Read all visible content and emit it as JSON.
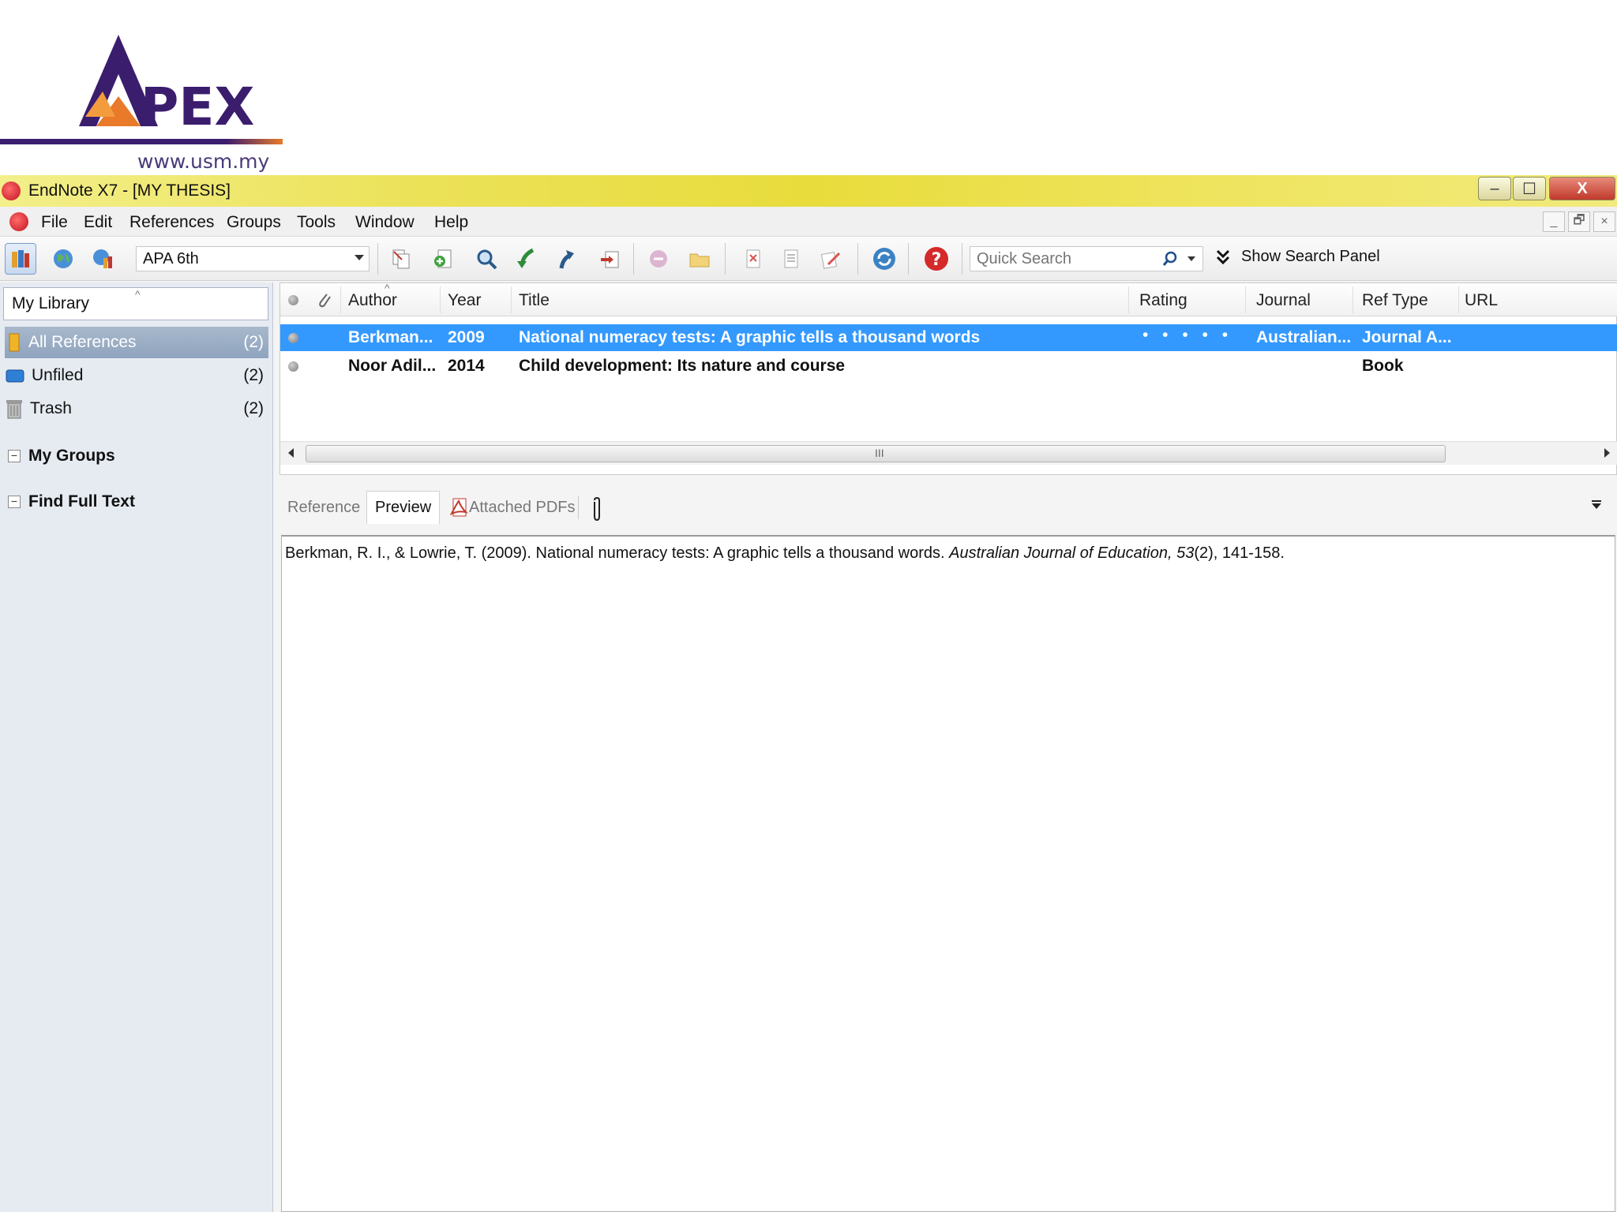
{
  "logo": {
    "text": "APEX",
    "url": "www.usm.my"
  },
  "window": {
    "title": "EndNote X7 - [MY THESIS]",
    "controls": {
      "minimize": "–",
      "maximize": "☐",
      "close": "X"
    }
  },
  "menu": {
    "items": [
      "File",
      "Edit",
      "References",
      "Groups",
      "Tools",
      "Window",
      "Help"
    ],
    "mdi": {
      "minimize": "_",
      "restore": "🗗",
      "close": "×"
    }
  },
  "toolbar": {
    "style": "APA 6th",
    "search_placeholder": "Quick Search",
    "show_search_panel": "Show Search Panel"
  },
  "library": {
    "header": "My Library",
    "items": [
      {
        "label": "All References",
        "count": "(2)",
        "selected": true
      },
      {
        "label": "Unfiled",
        "count": "(2)"
      },
      {
        "label": "Trash",
        "count": "(2)"
      }
    ],
    "groups": [
      "My Groups",
      "Find Full Text"
    ]
  },
  "reflist": {
    "columns": {
      "author": "Author",
      "year": "Year",
      "title": "Title",
      "rating": "Rating",
      "journal": "Journal",
      "reftype": "Ref Type",
      "url": "URL"
    },
    "rows": [
      {
        "author": "Berkman...",
        "year": "2009",
        "title": "National numeracy tests: A graphic tells a thousand words",
        "rating": "• • • • •",
        "journal": "Australian...",
        "reftype": "Journal A...",
        "selected": true
      },
      {
        "author": "Noor Adil...",
        "year": "2014",
        "title": "Child development: Its nature and course",
        "rating": "",
        "journal": "",
        "reftype": "Book"
      }
    ],
    "scroll_grip": "III"
  },
  "tabs": {
    "reference": "Reference",
    "preview": "Preview",
    "attached_pdfs": "Attached PDFs"
  },
  "preview": {
    "text_before": "Berkman, R. I., & Lowrie, T. (2009). National numeracy tests: A graphic tells a thousand words. ",
    "journal_italic": "Australian Journal of Education, 53",
    "text_after": "(2), 141-158."
  }
}
